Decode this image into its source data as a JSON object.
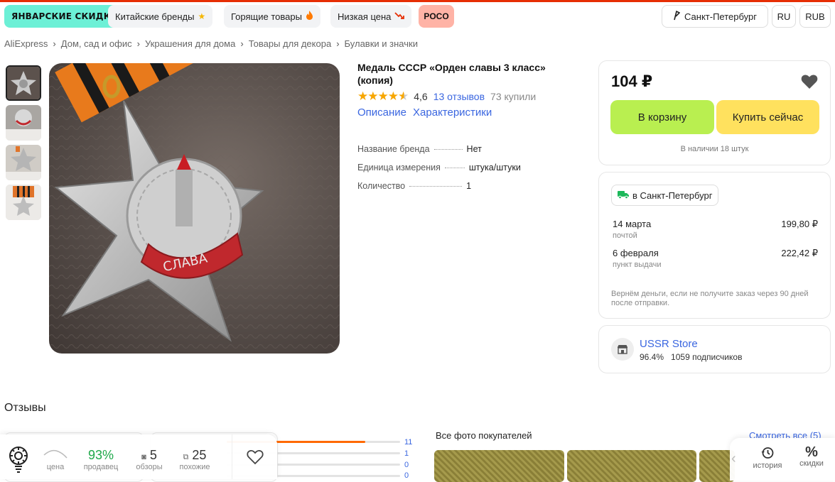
{
  "top_chips": {
    "sale": "ЯНВАРСКИЕ СКИДКИ",
    "brands": "Китайские бренды",
    "hot": "Горящие товары",
    "lowprice": "Низкая цена",
    "poco": "POCO"
  },
  "region": {
    "city": "Санкт-Петербург",
    "lang": "RU",
    "currency": "RUB"
  },
  "breadcrumbs": [
    "AliExpress",
    "Дом, сад и офис",
    "Украшения для дома",
    "Товары для декора",
    "Булавки и значки"
  ],
  "product": {
    "title": "Медаль СССР «Орден славы 3 класс» (копия)",
    "rating": "4,6",
    "rating_value": 4.6,
    "reviews": "13 отзывов",
    "bought": "73 купили",
    "tab_description": "Описание",
    "tab_specs": "Характеристики",
    "medal_ribbon_text": "СЛАВА",
    "specs": [
      {
        "name": "Название бренда",
        "value": "Нет"
      },
      {
        "name": "Единица измерения",
        "value": "штука/штуки"
      },
      {
        "name": "Количество",
        "value": "1"
      }
    ]
  },
  "buy": {
    "price": "104 ₽",
    "cart": "В корзину",
    "buy_now": "Купить сейчас",
    "stock": "В наличии 18 штук"
  },
  "delivery": {
    "to": "в Санкт-Петербург",
    "options": [
      {
        "date": "14 марта",
        "method": "почтой",
        "price": "199,80 ₽"
      },
      {
        "date": "6 февраля",
        "method": "пункт выдачи",
        "price": "222,42 ₽"
      }
    ],
    "note": "Вернём деньги, если не получите заказ через 90 дней после отправки."
  },
  "store": {
    "name": "USSR Store",
    "positive": "96.4%",
    "subscribers": "1059 подписчиков"
  },
  "reviews": {
    "title": "Отзывы",
    "bars": [
      {
        "count": "11",
        "share": 0.8
      },
      {
        "count": "1",
        "share": 0
      },
      {
        "count": "0",
        "share": 0
      },
      {
        "count": "0",
        "share": 0
      }
    ],
    "all_photos": "Все фото покупателей",
    "see_all": "Смотреть все (5)"
  },
  "bottom_bar": {
    "price_label": "цена",
    "seller_value": "93%",
    "seller_label": "продавец",
    "reviews_value": "5",
    "reviews_label": "обзоры",
    "similar_value": "25",
    "similar_label": "похожие"
  },
  "side_tools": {
    "history": "история",
    "discounts": "скидки"
  },
  "colors": {
    "accent": "#e62e04",
    "cart": "#b9ef50",
    "buy_now": "#ffe15e",
    "link": "#3a66e0",
    "sale_chip": "#6cf0d6",
    "poco_chip": "#ffb3a6",
    "star": "#f7a600"
  }
}
